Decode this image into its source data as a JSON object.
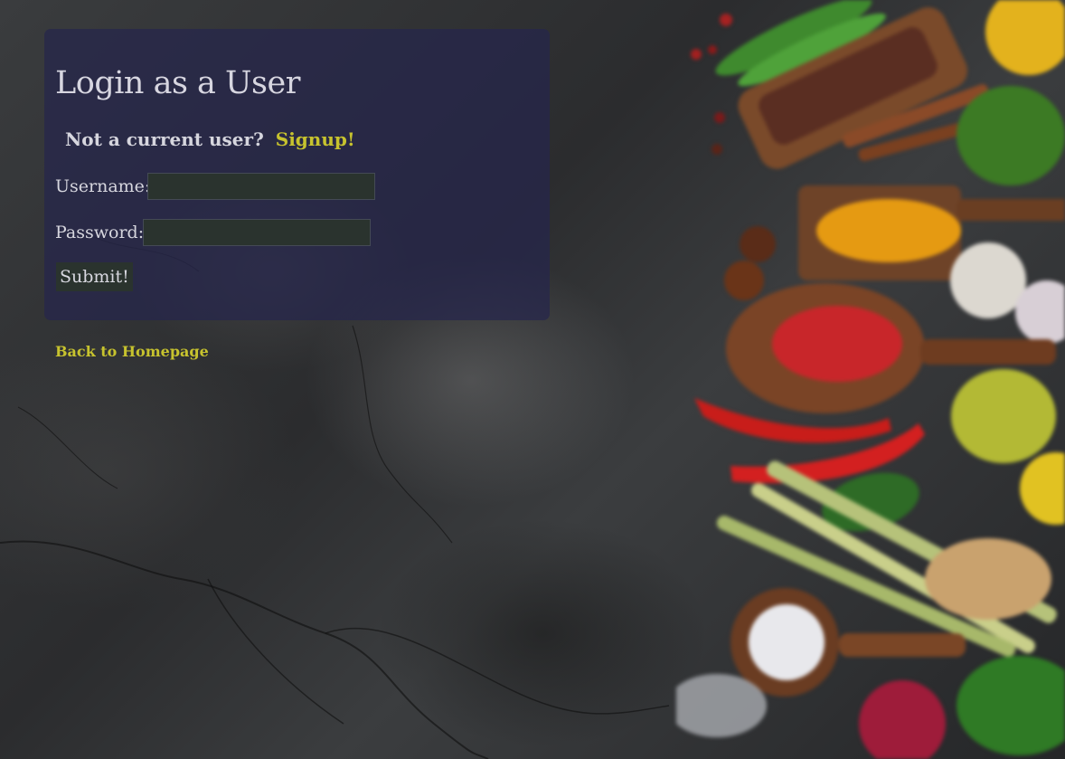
{
  "login": {
    "title": "Login as a User",
    "signup_prompt": "Not a current user?",
    "signup_link": "Signup!",
    "username_label": "Username:",
    "username_value": "",
    "password_label": "Password:",
    "password_value": "",
    "submit_label": "Submit!"
  },
  "nav": {
    "back_link": "Back to Homepage"
  },
  "colors": {
    "panel": "#26264c",
    "accent": "#c7c32e",
    "input_bg": "#2a332e"
  }
}
